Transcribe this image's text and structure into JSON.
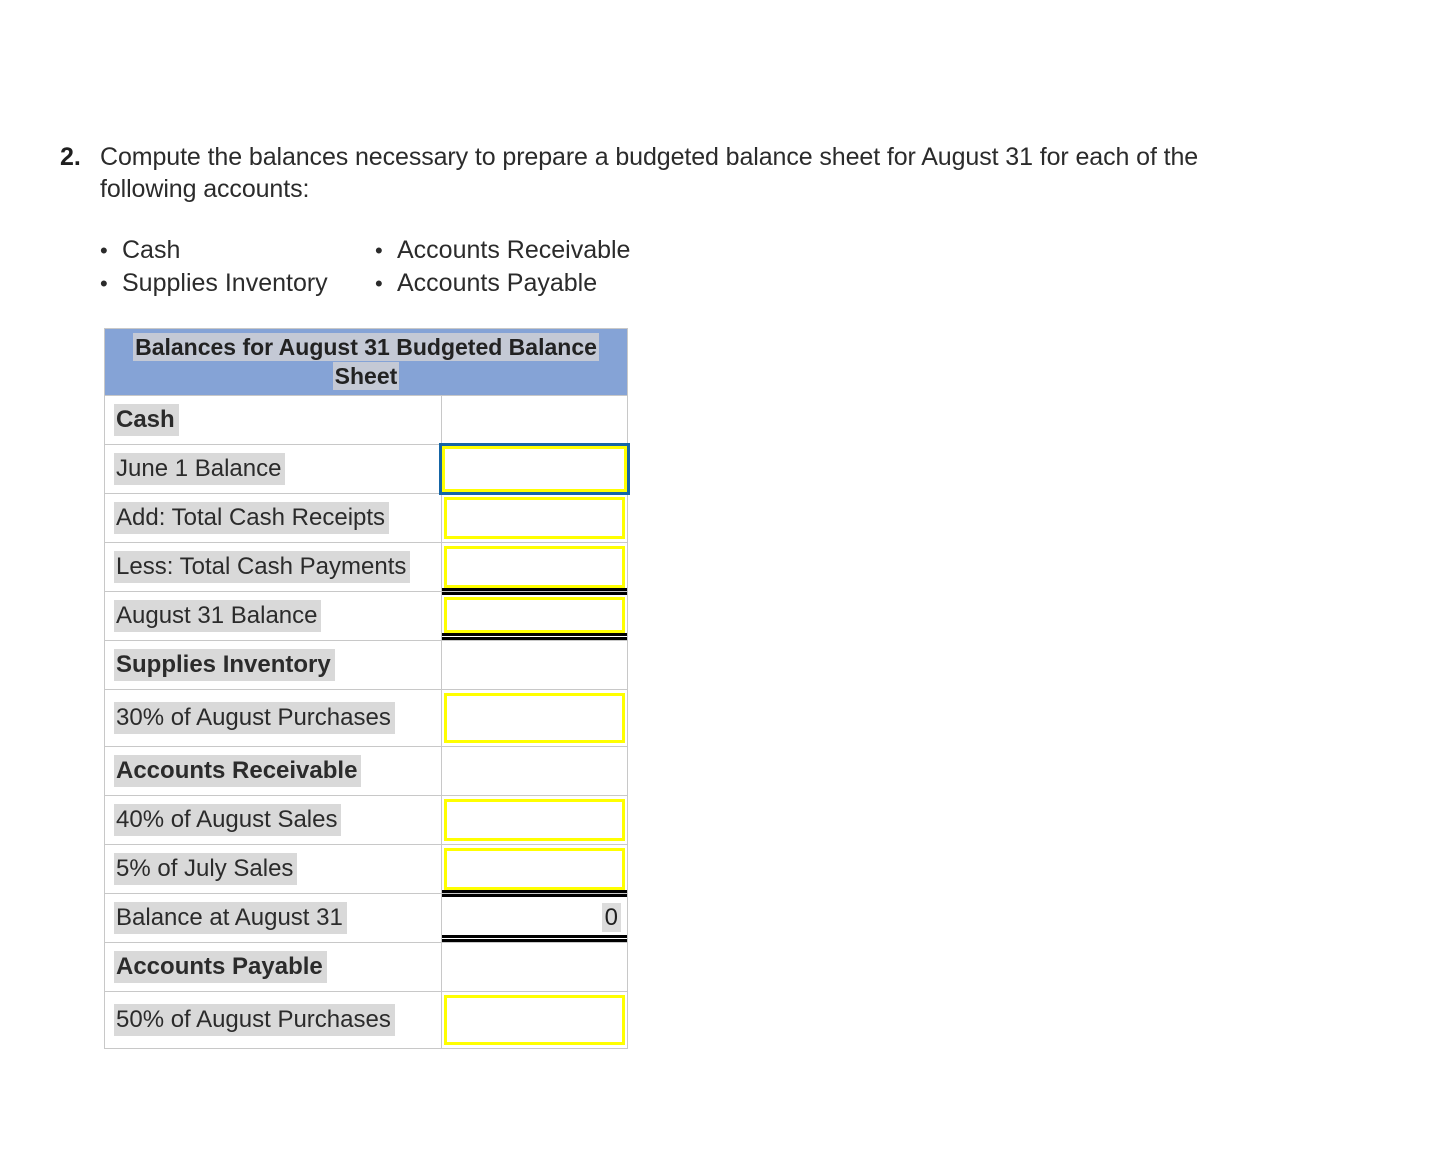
{
  "question": {
    "number": "2.",
    "text": "Compute the balances necessary to prepare a budgeted balance sheet for August 31 for each of the following accounts:"
  },
  "account_list": {
    "bullet_glyph": "•",
    "column_1": [
      "Cash",
      "Supplies Inventory"
    ],
    "column_2": [
      "Accounts Receivable",
      "Accounts Payable"
    ]
  },
  "colors": {
    "header_background": "#85a3d6",
    "header_text_highlight": "#c4c9d5",
    "label_highlight": "#d9d9d9",
    "input_border": "#ffff00",
    "focused_input_outline": "#1565a6",
    "rule": "#000000",
    "table_border": "#c8c8c8"
  },
  "table": {
    "title": "Balances for August 31 Budgeted Balance Sheet",
    "rows": [
      {
        "label": "Cash",
        "bold": true,
        "input": false,
        "value": ""
      },
      {
        "label": "June 1 Balance",
        "bold": false,
        "input": true,
        "value": ""
      },
      {
        "label": "Add: Total Cash Receipts",
        "bold": false,
        "input": true,
        "value": ""
      },
      {
        "label": "Less: Total Cash Payments",
        "bold": false,
        "input": true,
        "value": ""
      },
      {
        "label": "August 31 Balance",
        "bold": false,
        "input": true,
        "value": ""
      },
      {
        "label": "Supplies Inventory",
        "bold": true,
        "input": false,
        "value": ""
      },
      {
        "label": "30% of August Purchases",
        "bold": false,
        "input": true,
        "value": ""
      },
      {
        "label": "Accounts Receivable",
        "bold": true,
        "input": false,
        "value": ""
      },
      {
        "label": "40% of August Sales",
        "bold": false,
        "input": true,
        "value": ""
      },
      {
        "label": "5% of July Sales",
        "bold": false,
        "input": true,
        "value": ""
      },
      {
        "label": "Balance at August 31",
        "bold": false,
        "input": false,
        "value": "0"
      },
      {
        "label": "Accounts Payable",
        "bold": true,
        "input": false,
        "value": ""
      },
      {
        "label": "50% of August Purchases",
        "bold": false,
        "input": true,
        "value": ""
      }
    ]
  }
}
